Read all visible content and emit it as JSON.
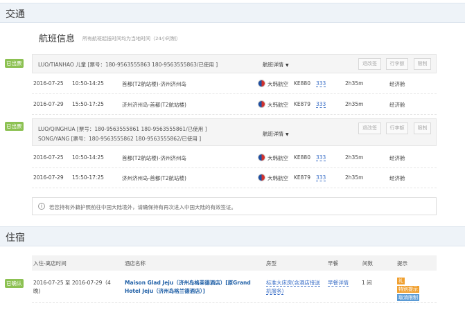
{
  "transport": {
    "section_title": "交通",
    "flight_title": "航班信息",
    "flight_note": "所有航班起抵时间均为当地时间（24小时制）",
    "orders": [
      {
        "status": "已出票",
        "passengers": [
          "LUO/TIANHAO 儿童 [票号：180-9563555863 180-9563555863/已使用 ]"
        ],
        "detail_label": "航班详情",
        "buttons": [
          "退改签",
          "行李额",
          "限制"
        ],
        "segments": [
          {
            "date": "2016-07-25",
            "time": "10:50-14:25",
            "route": "首都(T2航站楼)-济州济州岛",
            "airline": "大韩航空",
            "flight": "KE880",
            "seat": "333",
            "duration": "2h35m",
            "cabin": "经济舱"
          },
          {
            "date": "2016-07-29",
            "time": "15:50-17:25",
            "route": "济州济州岛-首都(T2航站楼)",
            "airline": "大韩航空",
            "flight": "KE879",
            "seat": "333",
            "duration": "2h35m",
            "cabin": "经济舱"
          }
        ]
      },
      {
        "status": "已出票",
        "passengers": [
          "LUO/QINGHUA [票号：180-9563555861 180-9563555861/已使用 ]",
          "SONG/YANG [票号：180-9563555862 180-9563555862/已使用 ]"
        ],
        "detail_label": "航班详情",
        "buttons": [
          "退改签",
          "行李额",
          "限制"
        ],
        "segments": [
          {
            "date": "2016-07-25",
            "time": "10:50-14:25",
            "route": "首都(T2航站楼)-济州济州岛",
            "airline": "大韩航空",
            "flight": "KE880",
            "seat": "333",
            "duration": "2h35m",
            "cabin": "经济舱"
          },
          {
            "date": "2016-07-29",
            "time": "15:50-17:25",
            "route": "济州济州岛-首都(T2航站楼)",
            "airline": "大韩航空",
            "flight": "KE879",
            "seat": "333",
            "duration": "2h35m",
            "cabin": "经济舱"
          }
        ]
      }
    ],
    "notice": "若您持有外籍护照前往中国大陆境外，请确保持有再次进入中国大陆的有效签证。"
  },
  "hotel": {
    "section_title": "住宿",
    "status": "已确认",
    "columns": [
      "入住-离店时间",
      "酒店名称",
      "房型",
      "早餐",
      "间数",
      "提示"
    ],
    "stay": "2016-07-25 至 2016-07-29（4晚)",
    "name": "Maison Glad Jeju（济州岛格莱德酒店）[原Grand Hotel Jeju（济州岛格兰德酒店）]",
    "room_type": "标准大床房(含酒店接送机服务)",
    "breakfast": "早餐详情",
    "rooms": "1 间",
    "tips": [
      {
        "label": "礼",
        "color": "#f0a030"
      },
      {
        "label": "特别提示",
        "color": "#f0a030"
      },
      {
        "label": "取消限制",
        "color": "#5b9bd5"
      }
    ]
  }
}
